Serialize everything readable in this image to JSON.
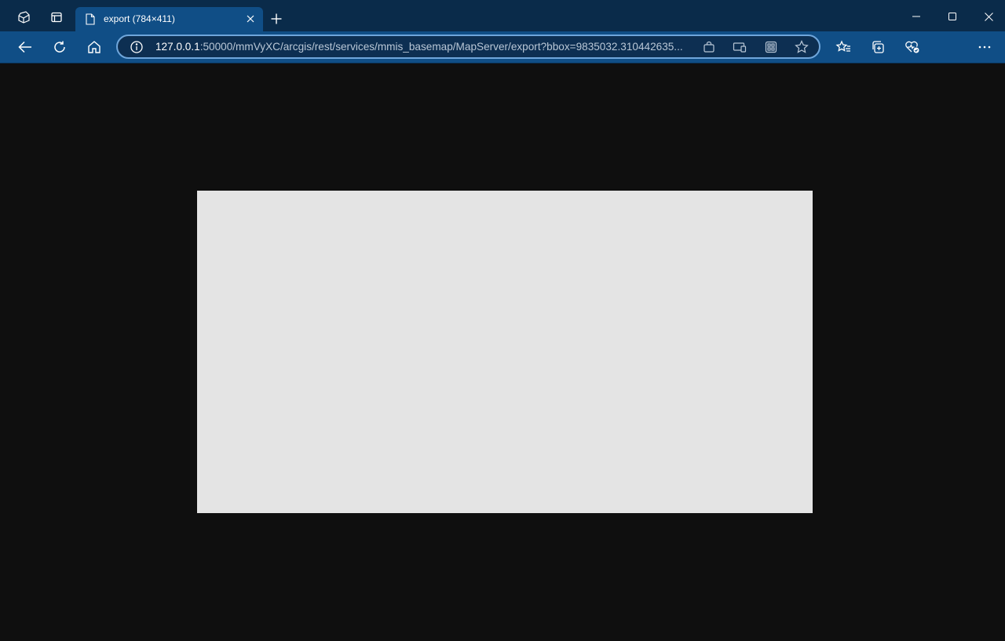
{
  "tab": {
    "title": "export (784×411)"
  },
  "address_bar": {
    "url_host": "127.0.0.1",
    "url_rest": ":50000/mmVyXC/arcgis/rest/services/mmis_basemap/MapServer/export?bbox=9835032.310442635..."
  },
  "colors": {
    "tabstrip_bg": "#0a2b4a",
    "toolbar_bg": "#104e86",
    "active_tab_bg": "#104e86",
    "page_bg": "#0f0f0f",
    "image_fill": "#e4e4e4"
  },
  "icons": {
    "tabstrip": [
      "workspaces-icon",
      "tab-actions-icon"
    ],
    "toolbar": [
      "back-arrow-icon",
      "refresh-icon",
      "home-icon"
    ],
    "address_bar": [
      "site-info-icon",
      "shopping-icon",
      "immersive-reader-icon",
      "apps-icon",
      "favorite-star-icon"
    ],
    "right_toolbar": [
      "favorites-icon",
      "collections-icon",
      "browser-essentials-icon",
      "more-menu-icon"
    ],
    "window": [
      "minimize-icon",
      "maximize-icon",
      "close-window-icon"
    ]
  }
}
